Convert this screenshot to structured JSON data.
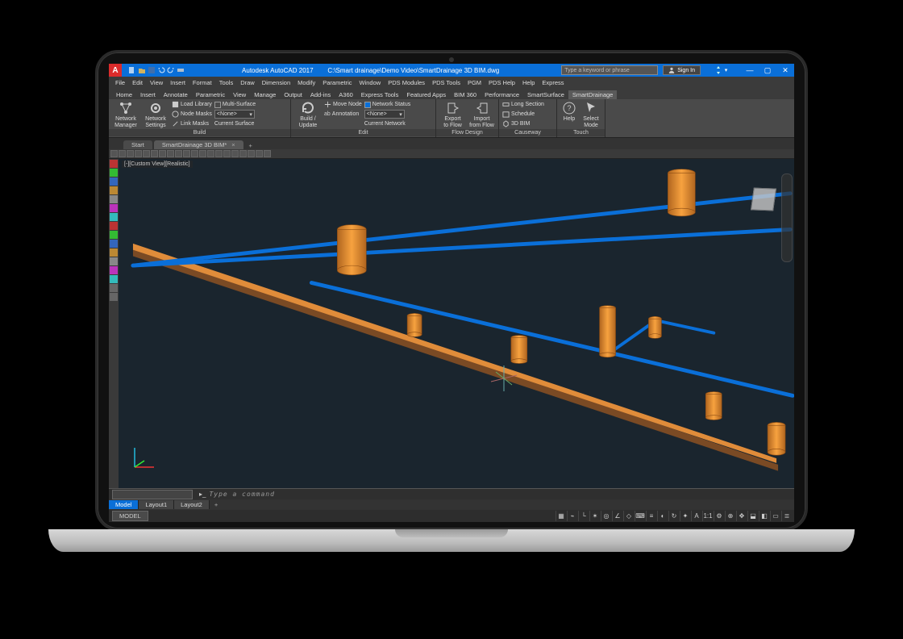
{
  "title": {
    "app": "Autodesk AutoCAD 2017",
    "path": "C:\\Smart drainage\\Demo Video\\SmartDrainage 3D BIM.dwg"
  },
  "search": {
    "placeholder": "Type a keyword or phrase"
  },
  "signin": {
    "label": "Sign In"
  },
  "menus": [
    "File",
    "Edit",
    "View",
    "Insert",
    "Format",
    "Tools",
    "Draw",
    "Dimension",
    "Modify",
    "Parametric",
    "Window",
    "PDS Modules",
    "PDS Tools",
    "PGM",
    "PDS Help",
    "Help",
    "Express"
  ],
  "ribtabs": [
    "Home",
    "Insert",
    "Annotate",
    "Parametric",
    "View",
    "Manage",
    "Output",
    "Add-ins",
    "A360",
    "Express Tools",
    "Featured Apps",
    "BIM 360",
    "Performance",
    "SmartSurface",
    "SmartDrainage"
  ],
  "ribtab_active": "SmartDrainage",
  "ribbon": {
    "build": {
      "title": "Build",
      "network_manager": "Network\nManager",
      "network_settings": "Network\nSettings",
      "load_library": "Load Library",
      "node_masks": "Node Masks",
      "link_masks": "Link Masks",
      "node_combo": "<None>",
      "multi_surface": "Multi-Surface",
      "current_surface": "Current Surface"
    },
    "edit": {
      "title": "Edit",
      "build_update": "Build /\nUpdate",
      "move_node": "Move Node",
      "annotation": "Annotation",
      "network_status": "Network Status",
      "net_combo": "<None>",
      "current_network": "Current Network"
    },
    "flow": {
      "title": "Flow Design",
      "export": "Export\nto Flow",
      "import": "Import\nfrom Flow"
    },
    "causeway": {
      "title": "Causeway",
      "long_section": "Long Section",
      "schedule": "Schedule",
      "bim": "3D BIM"
    },
    "touch": {
      "title": "Touch",
      "help": "Help",
      "select_mode": "Select\nMode"
    }
  },
  "doctabs": {
    "start": "Start",
    "active": "SmartDrainage 3D BIM*"
  },
  "viewport": {
    "label": "[-][Custom View][Realistic]"
  },
  "cmd": {
    "prompt": "Type a command"
  },
  "bottom_tabs": [
    "Model",
    "Layout1",
    "Layout2"
  ],
  "status": {
    "model": "MODEL"
  }
}
